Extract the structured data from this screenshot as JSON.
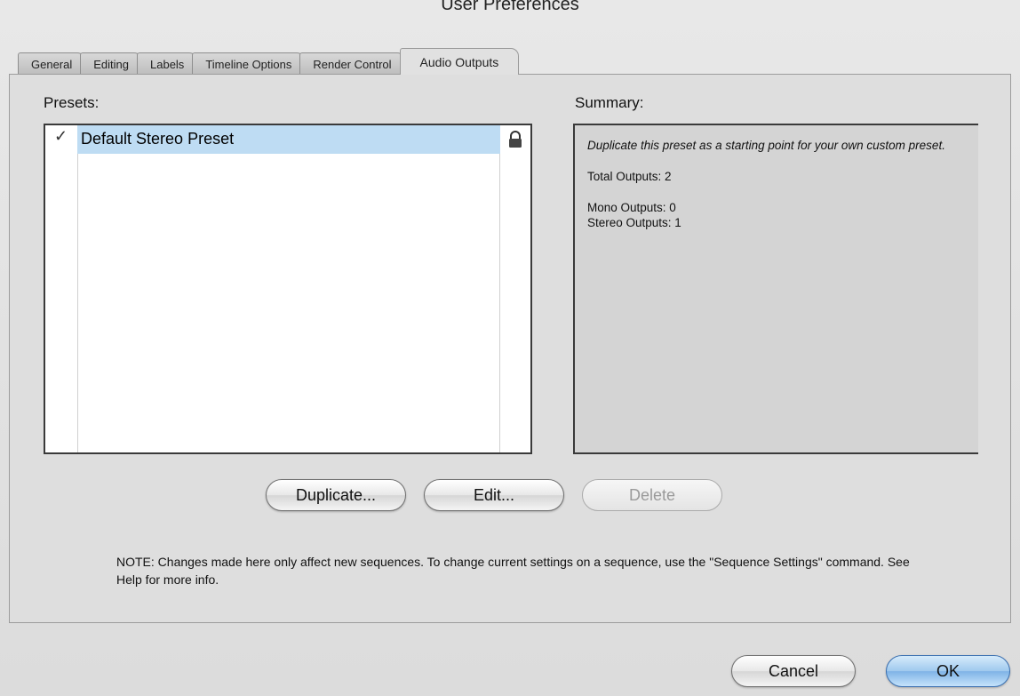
{
  "window": {
    "title": "User Preferences"
  },
  "tabs": [
    {
      "label": "General"
    },
    {
      "label": "Editing"
    },
    {
      "label": "Labels"
    },
    {
      "label": "Timeline Options"
    },
    {
      "label": "Render Control"
    },
    {
      "label": "Audio Outputs",
      "active": true
    }
  ],
  "presets": {
    "label": "Presets:",
    "items": [
      {
        "name": "Default Stereo Preset",
        "checked": true,
        "locked": true
      }
    ]
  },
  "summary": {
    "label": "Summary:",
    "description": "Duplicate this preset as a starting point for your own custom preset.",
    "total_outputs": "Total Outputs: 2",
    "mono_outputs": "Mono Outputs: 0",
    "stereo_outputs": "Stereo Outputs: 1"
  },
  "actions": {
    "duplicate": "Duplicate...",
    "edit": "Edit...",
    "delete": "Delete"
  },
  "note": "NOTE: Changes made here only affect new sequences. To change current settings on a sequence, use the \"Sequence Settings\" command. See Help for more info.",
  "footer": {
    "cancel": "Cancel",
    "ok": "OK"
  },
  "colors": {
    "selection": "#bedcf3",
    "default_button": "#7fb3e6"
  },
  "icons": {
    "check": "checkmark-icon",
    "lock": "lock-icon"
  }
}
